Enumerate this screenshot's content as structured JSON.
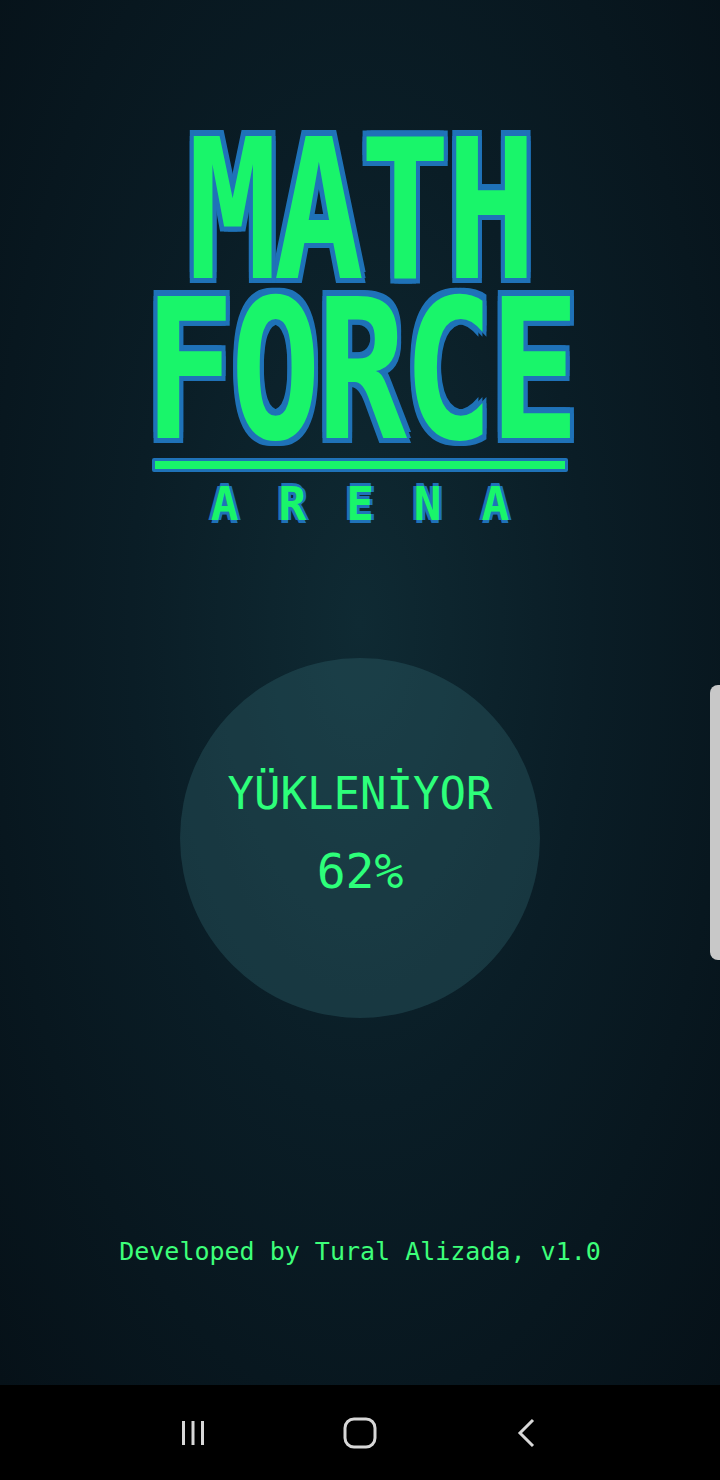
{
  "logo": {
    "line1": "MATH",
    "line2": "FORCE",
    "line3": "ARENA"
  },
  "loader": {
    "label": "YÜKLENİYOR",
    "percent": "62%"
  },
  "footer": {
    "credit": "Developed by Tural Alizada, v1.0"
  }
}
